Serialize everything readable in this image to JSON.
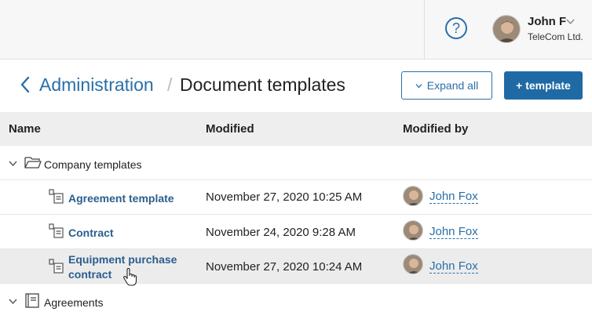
{
  "header": {
    "help_label": "?",
    "user_name": "John F",
    "user_company": "TeleCom Ltd."
  },
  "breadcrumb": {
    "parent": "Administration",
    "separator": "/",
    "current": "Document templates"
  },
  "toolbar": {
    "expand_label": "Expand all",
    "add_label": "+ template"
  },
  "table": {
    "columns": [
      "Name",
      "Modified",
      "Modified by"
    ],
    "groups": [
      {
        "label": "Company templates",
        "icon": "folder-open-icon",
        "items": [
          {
            "name": "Agreement template",
            "modified": "November 27, 2020 10:25 AM",
            "modified_by": "John Fox"
          },
          {
            "name": "Contract",
            "modified": "November 24, 2020 9:28 AM",
            "modified_by": "John Fox"
          },
          {
            "name_line1": "Equipment purchase",
            "name_line2": "contract",
            "modified": "November 27, 2020 10:24 AM",
            "modified_by": "John Fox"
          }
        ]
      },
      {
        "label": "Agreements",
        "icon": "book-icon",
        "items": []
      }
    ]
  },
  "colors": {
    "accent": "#2a6fa8",
    "primary_button": "#1f6aa5",
    "row_highlight": "#ececec",
    "header_bg": "#f7f7f7"
  }
}
